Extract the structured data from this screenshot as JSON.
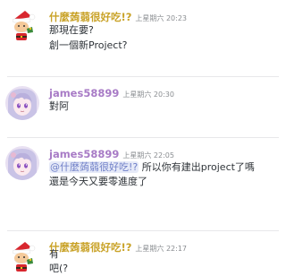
{
  "colors": {
    "user_gold": "#c9a227",
    "user_purple": "#a87bc6",
    "mention_bg": "#e6eaf8",
    "mention_text": "#6f7fc7",
    "timestamp": "#8a8d91",
    "text": "#2e3338"
  },
  "messages": [
    {
      "username": "什麼蒟蒻很好吃!?",
      "timestamp": "上星期六 20:23",
      "avatar_icon": "santa-character-avatar",
      "lines": [
        "那現在要?",
        "創一個新Project?"
      ]
    },
    {
      "username": "james58899",
      "timestamp": "上星期六 20:30",
      "avatar_icon": "anime-girl-avatar",
      "lines": [
        "對阿"
      ]
    },
    {
      "username": "james58899",
      "timestamp": "上星期六 22:05",
      "avatar_icon": "anime-girl-avatar",
      "mention": "@什麼蒟蒻很好吃!?",
      "lines": [
        "所以你有建出project了嗎",
        "還是今天又要零進度了"
      ]
    },
    {
      "username": "什麼蒟蒻很好吃!?",
      "timestamp": "上星期六 22:17",
      "avatar_icon": "santa-character-avatar",
      "lines": [
        "有",
        "吧(?"
      ]
    }
  ]
}
